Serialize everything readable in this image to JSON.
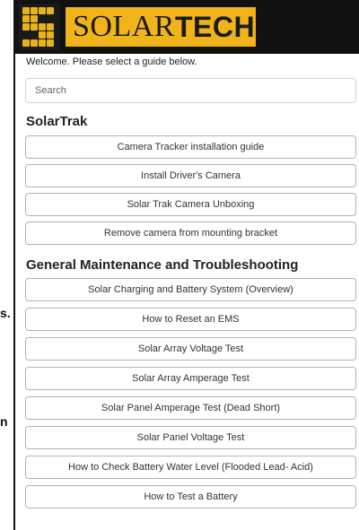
{
  "background_fragments": [
    "s.",
    "n"
  ],
  "header": {
    "logo_prefix": "SOLAR",
    "logo_suffix": "TECH",
    "brand_yellow": "#f0b41a",
    "brand_dark": "#111111"
  },
  "welcome_text": "Welcome. Please select a guide below.",
  "search": {
    "placeholder": "Search"
  },
  "sections": [
    {
      "title": "SolarTrak",
      "items": [
        "Camera Tracker installation guide",
        "Install Driver's Camera",
        "Solar Trak Camera Unboxing",
        "Remove camera from mounting bracket"
      ]
    },
    {
      "title": "General Maintenance and Troubleshooting",
      "items": [
        "Solar Charging and Battery System (Overview)",
        "How to Reset an EMS",
        "Solar Array Voltage Test",
        "Solar Array Amperage Test",
        "Solar Panel Amperage Test (Dead Short)",
        "Solar Panel Voltage Test",
        "How to Check Battery Water Level (Flooded Lead- Acid)",
        "How to Test a Battery"
      ]
    }
  ]
}
